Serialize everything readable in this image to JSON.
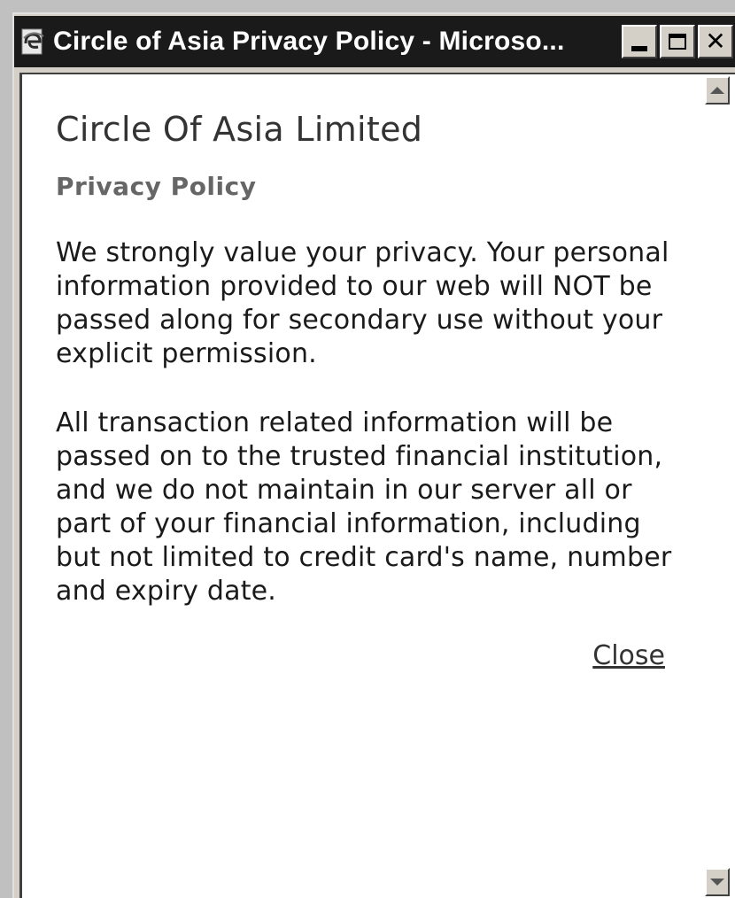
{
  "window": {
    "title": "Circle of Asia Privacy Policy - Microso...",
    "app_icon": "ie-browser-icon",
    "buttons": {
      "minimize": "minimize-icon",
      "maximize": "maximize-icon",
      "close_glyph": "✕"
    }
  },
  "page": {
    "company_name": "Circle Of Asia Limited",
    "heading": "Privacy Policy",
    "paragraphs": [
      "We strongly value your privacy. Your personal information provided to our web will NOT be passed along for secondary use without your explicit permission.",
      "All transaction related information will be passed on to the trusted financial institution, and we do not maintain in our server all or part of your financial information, including but not limited to credit card's name, number and expiry date."
    ],
    "close_link": "Close"
  },
  "colors": {
    "titlebar": "#1a1a1a",
    "chrome": "#d4d0c8",
    "text": "#1a1a1a",
    "heading": "#666666"
  }
}
